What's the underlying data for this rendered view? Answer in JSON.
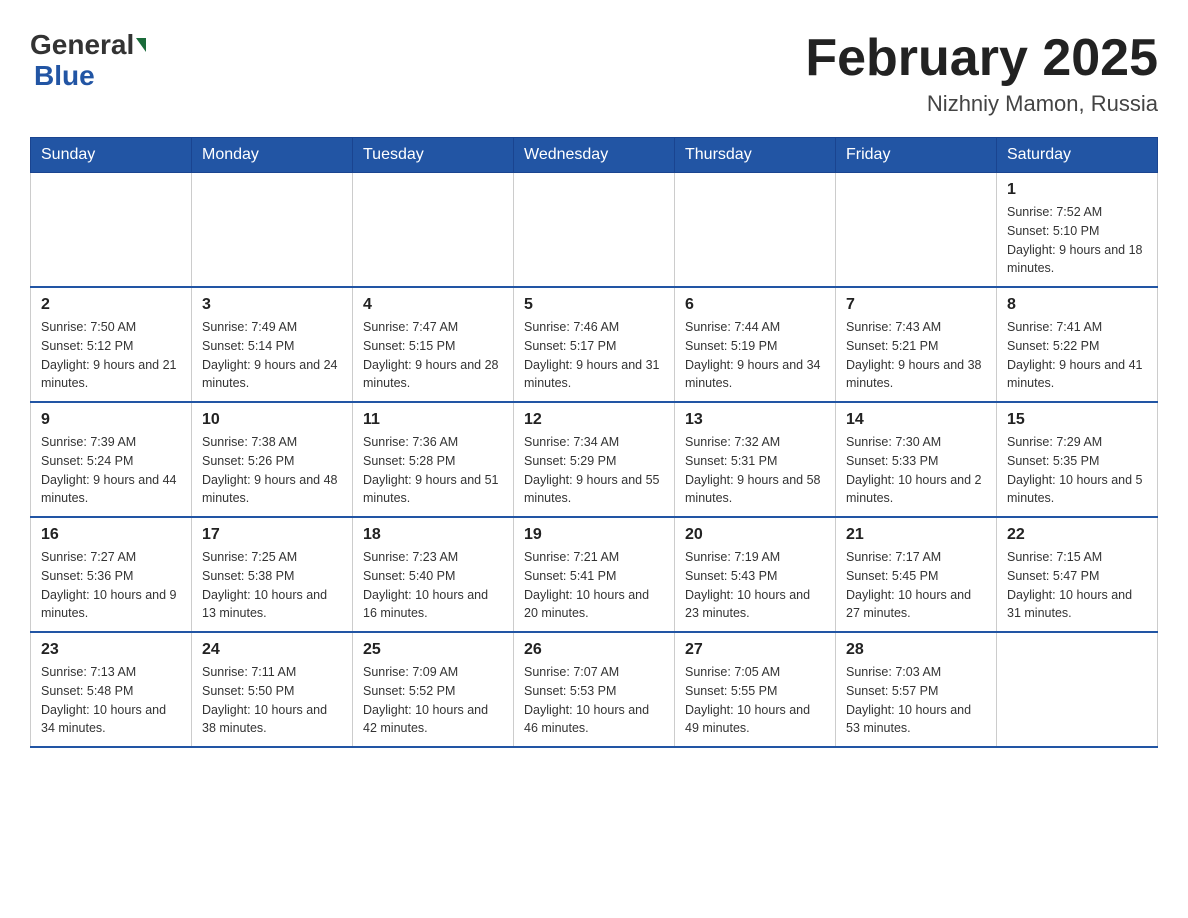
{
  "header": {
    "logo_general": "General",
    "logo_blue": "Blue",
    "title": "February 2025",
    "subtitle": "Nizhniy Mamon, Russia"
  },
  "weekdays": [
    "Sunday",
    "Monday",
    "Tuesday",
    "Wednesday",
    "Thursday",
    "Friday",
    "Saturday"
  ],
  "weeks": [
    [
      {
        "day": "",
        "info": ""
      },
      {
        "day": "",
        "info": ""
      },
      {
        "day": "",
        "info": ""
      },
      {
        "day": "",
        "info": ""
      },
      {
        "day": "",
        "info": ""
      },
      {
        "day": "",
        "info": ""
      },
      {
        "day": "1",
        "info": "Sunrise: 7:52 AM\nSunset: 5:10 PM\nDaylight: 9 hours and 18 minutes."
      }
    ],
    [
      {
        "day": "2",
        "info": "Sunrise: 7:50 AM\nSunset: 5:12 PM\nDaylight: 9 hours and 21 minutes."
      },
      {
        "day": "3",
        "info": "Sunrise: 7:49 AM\nSunset: 5:14 PM\nDaylight: 9 hours and 24 minutes."
      },
      {
        "day": "4",
        "info": "Sunrise: 7:47 AM\nSunset: 5:15 PM\nDaylight: 9 hours and 28 minutes."
      },
      {
        "day": "5",
        "info": "Sunrise: 7:46 AM\nSunset: 5:17 PM\nDaylight: 9 hours and 31 minutes."
      },
      {
        "day": "6",
        "info": "Sunrise: 7:44 AM\nSunset: 5:19 PM\nDaylight: 9 hours and 34 minutes."
      },
      {
        "day": "7",
        "info": "Sunrise: 7:43 AM\nSunset: 5:21 PM\nDaylight: 9 hours and 38 minutes."
      },
      {
        "day": "8",
        "info": "Sunrise: 7:41 AM\nSunset: 5:22 PM\nDaylight: 9 hours and 41 minutes."
      }
    ],
    [
      {
        "day": "9",
        "info": "Sunrise: 7:39 AM\nSunset: 5:24 PM\nDaylight: 9 hours and 44 minutes."
      },
      {
        "day": "10",
        "info": "Sunrise: 7:38 AM\nSunset: 5:26 PM\nDaylight: 9 hours and 48 minutes."
      },
      {
        "day": "11",
        "info": "Sunrise: 7:36 AM\nSunset: 5:28 PM\nDaylight: 9 hours and 51 minutes."
      },
      {
        "day": "12",
        "info": "Sunrise: 7:34 AM\nSunset: 5:29 PM\nDaylight: 9 hours and 55 minutes."
      },
      {
        "day": "13",
        "info": "Sunrise: 7:32 AM\nSunset: 5:31 PM\nDaylight: 9 hours and 58 minutes."
      },
      {
        "day": "14",
        "info": "Sunrise: 7:30 AM\nSunset: 5:33 PM\nDaylight: 10 hours and 2 minutes."
      },
      {
        "day": "15",
        "info": "Sunrise: 7:29 AM\nSunset: 5:35 PM\nDaylight: 10 hours and 5 minutes."
      }
    ],
    [
      {
        "day": "16",
        "info": "Sunrise: 7:27 AM\nSunset: 5:36 PM\nDaylight: 10 hours and 9 minutes."
      },
      {
        "day": "17",
        "info": "Sunrise: 7:25 AM\nSunset: 5:38 PM\nDaylight: 10 hours and 13 minutes."
      },
      {
        "day": "18",
        "info": "Sunrise: 7:23 AM\nSunset: 5:40 PM\nDaylight: 10 hours and 16 minutes."
      },
      {
        "day": "19",
        "info": "Sunrise: 7:21 AM\nSunset: 5:41 PM\nDaylight: 10 hours and 20 minutes."
      },
      {
        "day": "20",
        "info": "Sunrise: 7:19 AM\nSunset: 5:43 PM\nDaylight: 10 hours and 23 minutes."
      },
      {
        "day": "21",
        "info": "Sunrise: 7:17 AM\nSunset: 5:45 PM\nDaylight: 10 hours and 27 minutes."
      },
      {
        "day": "22",
        "info": "Sunrise: 7:15 AM\nSunset: 5:47 PM\nDaylight: 10 hours and 31 minutes."
      }
    ],
    [
      {
        "day": "23",
        "info": "Sunrise: 7:13 AM\nSunset: 5:48 PM\nDaylight: 10 hours and 34 minutes."
      },
      {
        "day": "24",
        "info": "Sunrise: 7:11 AM\nSunset: 5:50 PM\nDaylight: 10 hours and 38 minutes."
      },
      {
        "day": "25",
        "info": "Sunrise: 7:09 AM\nSunset: 5:52 PM\nDaylight: 10 hours and 42 minutes."
      },
      {
        "day": "26",
        "info": "Sunrise: 7:07 AM\nSunset: 5:53 PM\nDaylight: 10 hours and 46 minutes."
      },
      {
        "day": "27",
        "info": "Sunrise: 7:05 AM\nSunset: 5:55 PM\nDaylight: 10 hours and 49 minutes."
      },
      {
        "day": "28",
        "info": "Sunrise: 7:03 AM\nSunset: 5:57 PM\nDaylight: 10 hours and 53 minutes."
      },
      {
        "day": "",
        "info": ""
      }
    ]
  ]
}
